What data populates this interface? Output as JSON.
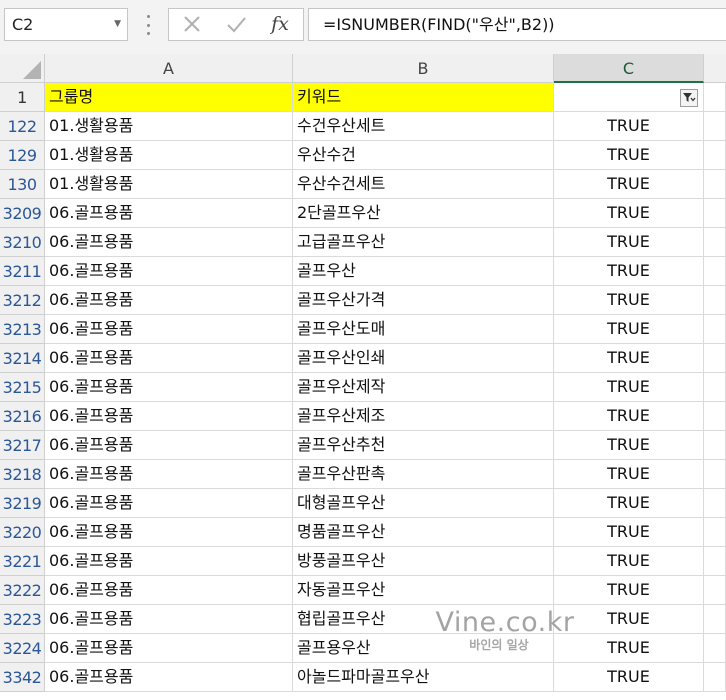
{
  "formula_bar": {
    "name_box": "C2",
    "formula": "=ISNUMBER(FIND(\"우산\",B2))",
    "icons": {
      "cancel": "close-icon",
      "confirm": "check-icon",
      "function": "fx-icon"
    },
    "fx_label": "fx"
  },
  "columns": [
    {
      "label": "A"
    },
    {
      "label": "B"
    },
    {
      "label": "C"
    }
  ],
  "header_row": {
    "row_number": "1",
    "group": "그룹명",
    "keyword": "키워드",
    "result": ""
  },
  "rows": [
    {
      "num": "122",
      "group": "01.생활용품",
      "keyword": "수건우산세트",
      "result": "TRUE"
    },
    {
      "num": "129",
      "group": "01.생활용품",
      "keyword": "우산수건",
      "result": "TRUE"
    },
    {
      "num": "130",
      "group": "01.생활용품",
      "keyword": "우산수건세트",
      "result": "TRUE"
    },
    {
      "num": "3209",
      "group": "06.골프용품",
      "keyword": "2단골프우산",
      "result": "TRUE"
    },
    {
      "num": "3210",
      "group": "06.골프용품",
      "keyword": "고급골프우산",
      "result": "TRUE"
    },
    {
      "num": "3211",
      "group": "06.골프용품",
      "keyword": "골프우산",
      "result": "TRUE"
    },
    {
      "num": "3212",
      "group": "06.골프용품",
      "keyword": "골프우산가격",
      "result": "TRUE"
    },
    {
      "num": "3213",
      "group": "06.골프용품",
      "keyword": "골프우산도매",
      "result": "TRUE"
    },
    {
      "num": "3214",
      "group": "06.골프용품",
      "keyword": "골프우산인쇄",
      "result": "TRUE"
    },
    {
      "num": "3215",
      "group": "06.골프용품",
      "keyword": "골프우산제작",
      "result": "TRUE"
    },
    {
      "num": "3216",
      "group": "06.골프용품",
      "keyword": "골프우산제조",
      "result": "TRUE"
    },
    {
      "num": "3217",
      "group": "06.골프용품",
      "keyword": "골프우산추천",
      "result": "TRUE"
    },
    {
      "num": "3218",
      "group": "06.골프용품",
      "keyword": "골프우산판촉",
      "result": "TRUE"
    },
    {
      "num": "3219",
      "group": "06.골프용품",
      "keyword": "대형골프우산",
      "result": "TRUE"
    },
    {
      "num": "3220",
      "group": "06.골프용품",
      "keyword": "명품골프우산",
      "result": "TRUE"
    },
    {
      "num": "3221",
      "group": "06.골프용품",
      "keyword": "방풍골프우산",
      "result": "TRUE"
    },
    {
      "num": "3222",
      "group": "06.골프용품",
      "keyword": "자동골프우산",
      "result": "TRUE"
    },
    {
      "num": "3223",
      "group": "06.골프용품",
      "keyword": "협립골프우산",
      "result": "TRUE"
    },
    {
      "num": "3224",
      "group": "06.골프용품",
      "keyword": "골프용우산",
      "result": "TRUE"
    },
    {
      "num": "3342",
      "group": "06.골프용품",
      "keyword": "아놀드파마골프우산",
      "result": "TRUE"
    }
  ],
  "filter_icon": "filter-icon",
  "watermark": {
    "line1": "Vine.co.kr",
    "line2": "바인의 일상"
  },
  "colors": {
    "header_fill": "#ffff00",
    "row_number_filtered": "#2b5797",
    "selection": "#1e7145"
  }
}
